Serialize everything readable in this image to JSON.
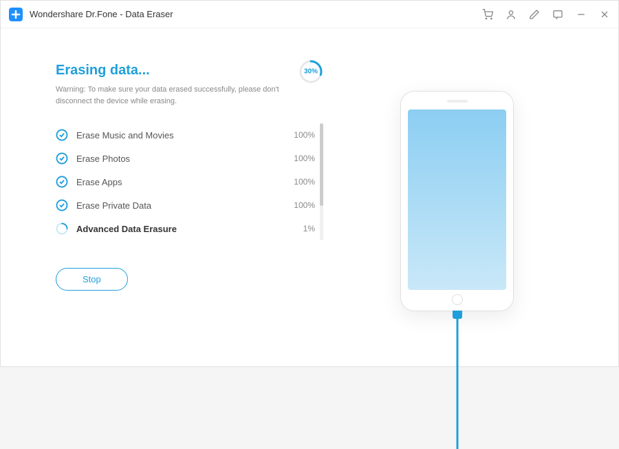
{
  "titlebar": {
    "title": "Wondershare Dr.Fone - Data Eraser"
  },
  "main": {
    "heading": "Erasing data...",
    "warning": "Warning: To make sure your data erased successfully, please don't disconnect the device while erasing.",
    "progress_percent": "30%",
    "progress_value": 30,
    "tasks": [
      {
        "label": "Erase Music and Movies",
        "percent": "100%",
        "status": "done"
      },
      {
        "label": "Erase Photos",
        "percent": "100%",
        "status": "done"
      },
      {
        "label": "Erase Apps",
        "percent": "100%",
        "status": "done"
      },
      {
        "label": "Erase Private Data",
        "percent": "100%",
        "status": "done"
      },
      {
        "label": "Advanced Data Erasure",
        "percent": "1%",
        "status": "active"
      }
    ],
    "stop_label": "Stop"
  },
  "colors": {
    "accent": "#1E9FDB"
  }
}
